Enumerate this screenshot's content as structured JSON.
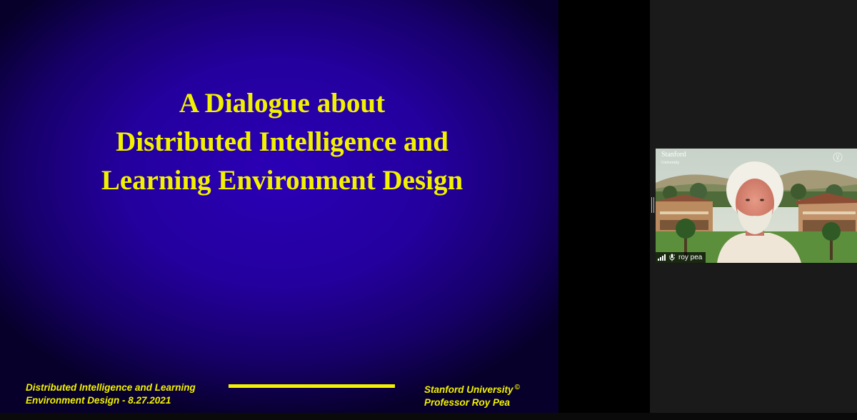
{
  "slide": {
    "title_lines": [
      "A Dialogue about",
      "Distributed Intelligence and",
      "Learning Environment Design"
    ],
    "footer_left_lines": [
      "Distributed Intelligence and Learning",
      "Environment Design - 8.27.2021"
    ],
    "footer_right_lines": [
      "Stanford University",
      "Professor Roy Pea"
    ],
    "copyright_symbol": "©",
    "text_color": "#f2f200",
    "background_color": "#2400a0"
  },
  "participant": {
    "name": "roy pea",
    "background_logo_main": "Stanford",
    "background_logo_sub": "University",
    "icons": [
      "signal-strength-icon",
      "microphone-icon"
    ]
  }
}
